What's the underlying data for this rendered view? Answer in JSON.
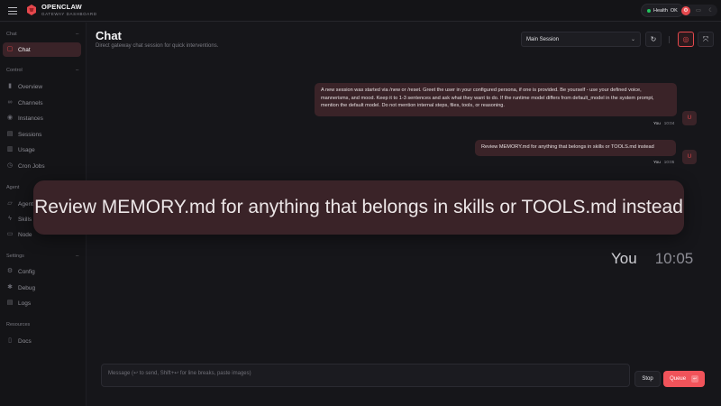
{
  "app": {
    "name": "OPENCLAW",
    "subtitle": "GATEWAY DASHBOARD"
  },
  "topbar": {
    "health_label": "Health",
    "health_value": "OK",
    "health_color": "#22c55e",
    "icons": [
      "settings-icon",
      "monitor-icon",
      "moon-icon"
    ]
  },
  "sidebar": {
    "sections": [
      {
        "label": "Chat",
        "items": [
          {
            "label": "Chat",
            "icon": "chat-bubble-icon",
            "active": true
          }
        ]
      },
      {
        "label": "Control",
        "items": [
          {
            "label": "Overview",
            "icon": "bar-chart-icon"
          },
          {
            "label": "Channels",
            "icon": "link-icon"
          },
          {
            "label": "Instances",
            "icon": "radio-icon"
          },
          {
            "label": "Sessions",
            "icon": "document-icon"
          },
          {
            "label": "Usage",
            "icon": "usage-icon"
          },
          {
            "label": "Cron Jobs",
            "icon": "clock-icon"
          }
        ]
      },
      {
        "label": "Agent",
        "items": [
          {
            "label": "Agent",
            "icon": "folder-icon"
          },
          {
            "label": "Skills",
            "icon": "bolt-icon"
          },
          {
            "label": "Node",
            "icon": "monitor-icon"
          }
        ]
      },
      {
        "label": "Settings",
        "items": [
          {
            "label": "Config",
            "icon": "gear-icon"
          },
          {
            "label": "Debug",
            "icon": "bug-icon"
          },
          {
            "label": "Logs",
            "icon": "logs-icon"
          }
        ]
      },
      {
        "label": "Resources",
        "items": [
          {
            "label": "Docs",
            "icon": "book-icon"
          }
        ]
      }
    ]
  },
  "main": {
    "title": "Chat",
    "subtitle": "Direct gateway chat session for quick interventions.",
    "session_select": "Main Session"
  },
  "messages": [
    {
      "text": "A new session was started via /new or /reset. Greet the user in your configured persona, if one is provided. Be yourself - use your defined voice, mannerisms, and mood. Keep it to 1-3 sentences and ask what they want to do. If the runtime model differs from default_model in the system prompt, mention the default model. Do not mention internal steps, files, tools, or reasoning.",
      "sender": "You",
      "time": "10:04",
      "avatar": "U"
    },
    {
      "text": "Review MEMORY.md for anything that belongs in skills or TOOLS.md instead",
      "sender": "You",
      "time": "10:05",
      "avatar": "U"
    }
  ],
  "composer": {
    "placeholder": "Message (↩ to send, Shift+↩ for line breaks, paste images)",
    "stop_label": "Stop",
    "queue_label": "Queue",
    "queue_shortcut": "↩"
  },
  "accent_color": "#e5484d"
}
